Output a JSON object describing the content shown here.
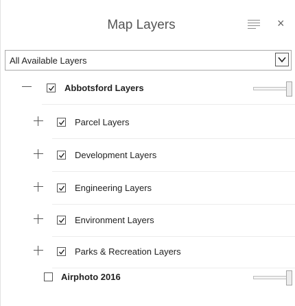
{
  "header": {
    "title": "Map Layers",
    "menu_icon": "hamburger-menu-icon",
    "close_icon": "close-icon",
    "close_glyph": "×"
  },
  "filter": {
    "selected": "All Available Layers",
    "arrow_icon": "chevron-down-icon"
  },
  "layers": [
    {
      "label": "Abbotsford Layers",
      "checked": true,
      "expanded": true,
      "bold": true,
      "has_slider": true,
      "opacity": 1.0
    },
    {
      "label": "Parcel Layers",
      "checked": true,
      "expanded": false,
      "bold": false
    },
    {
      "label": "Development Layers",
      "checked": true,
      "expanded": false,
      "bold": false
    },
    {
      "label": "Engineering Layers",
      "checked": true,
      "expanded": false,
      "bold": false
    },
    {
      "label": "Environment Layers",
      "checked": true,
      "expanded": false,
      "bold": false
    },
    {
      "label": "Parks & Recreation Layers",
      "checked": true,
      "expanded": false,
      "bold": false
    },
    {
      "label": "Airphoto 2016",
      "checked": false,
      "bold": true,
      "has_slider": true,
      "opacity": 1.0
    }
  ],
  "colors": {
    "border": "#a9a9a9",
    "separator": "#ececec",
    "text": "#222222"
  }
}
